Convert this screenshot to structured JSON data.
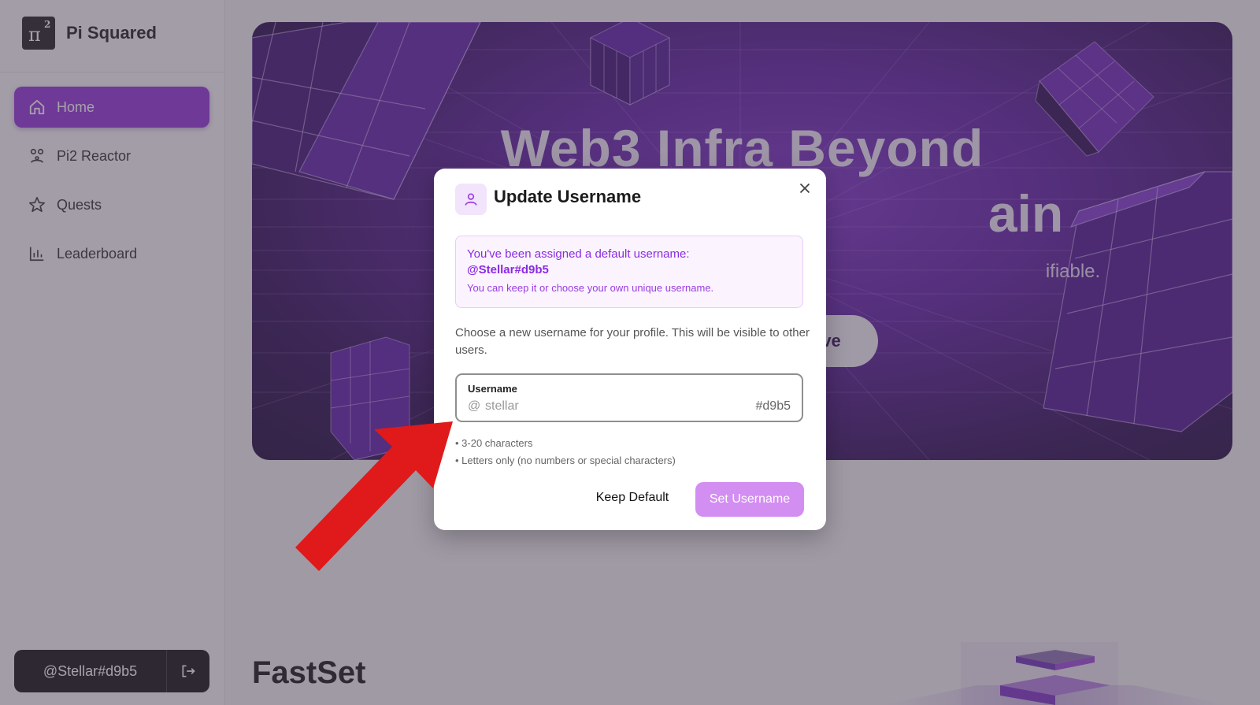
{
  "brand": {
    "name": "Pi Squared",
    "logo_text": "π",
    "logo_sup": "2"
  },
  "sidebar": {
    "items": [
      {
        "label": "Home",
        "icon": "home-icon",
        "active": true
      },
      {
        "label": "Pi2 Reactor",
        "icon": "reactor-icon",
        "active": false
      },
      {
        "label": "Quests",
        "icon": "star-icon",
        "active": false
      },
      {
        "label": "Leaderboard",
        "icon": "bar-chart-icon",
        "active": false
      }
    ],
    "user": {
      "handle": "@Stellar#d9b5",
      "logout_icon": "logout-icon"
    }
  },
  "hero": {
    "title_line1": "Web3 Infra Beyond",
    "title_line2": "ain",
    "subtitle_fragment": "ifiable.",
    "button_fragment": "ive"
  },
  "section": {
    "title": "FastSet"
  },
  "modal": {
    "title": "Update Username",
    "icon": "user-icon",
    "close_icon": "close-icon",
    "notice": {
      "line": "You've been assigned a default username:",
      "username": "@Stellar#d9b5",
      "small": "You can keep it or choose your own unique username."
    },
    "description": "Choose a new username for your profile. This will be visible to other users.",
    "field": {
      "label": "Username",
      "prefix": "@",
      "placeholder": "stellar",
      "value": "",
      "suffix": "#d9b5"
    },
    "hints": [
      "• 3-20 characters",
      "• Letters only (no numbers or special characters)"
    ],
    "buttons": {
      "keep": "Keep Default",
      "set": "Set Username"
    }
  },
  "colors": {
    "accent": "#8f2fd8",
    "set_button": "#d38ef2",
    "annotation_arrow": "#e0191a"
  }
}
